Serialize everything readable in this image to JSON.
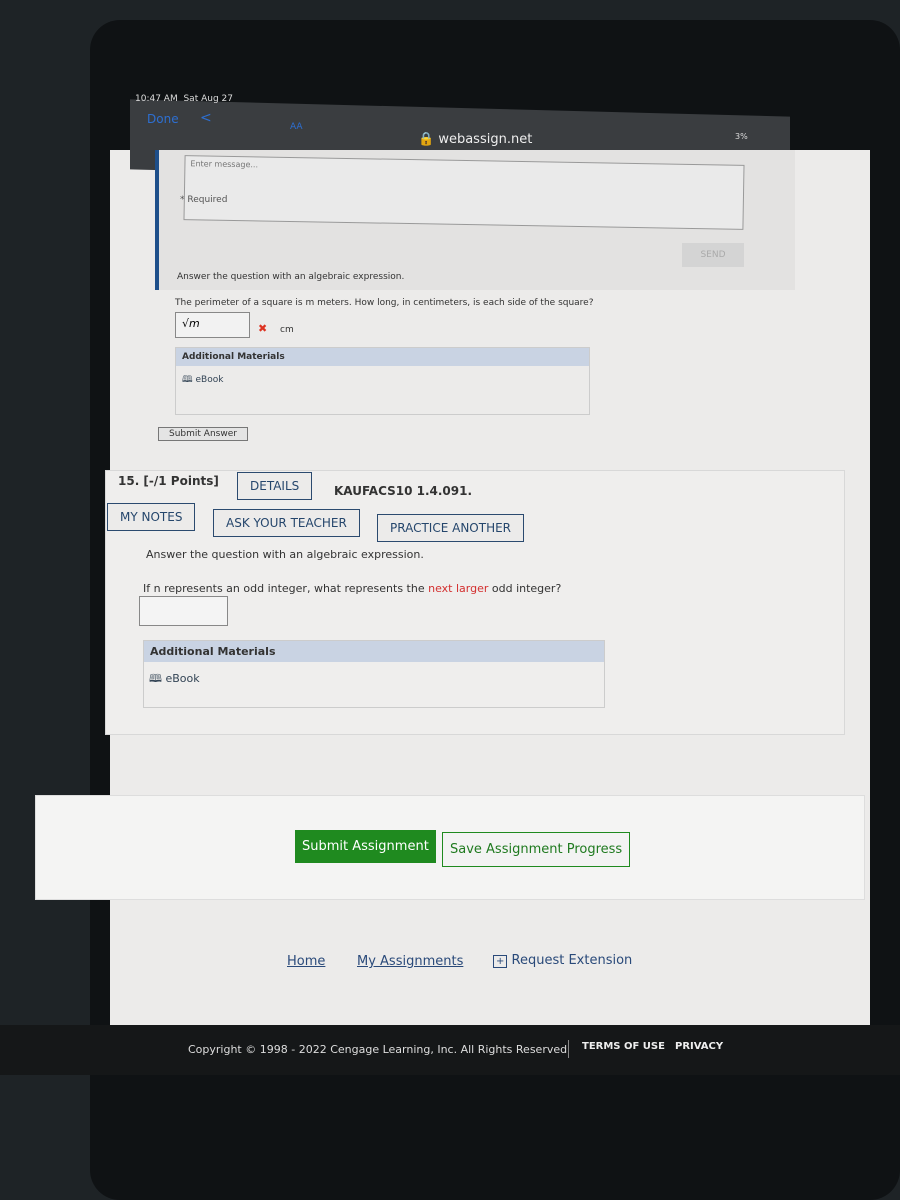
{
  "status": {
    "time": "10:47 AM",
    "date": "Sat Aug 27",
    "battery": "3%"
  },
  "browser": {
    "done": "Done",
    "back": "<",
    "text_size": "AA",
    "url": "webassign.net"
  },
  "message": {
    "placeholder": "Enter message...",
    "required": "* Required",
    "send": "SEND"
  },
  "q14": {
    "instruction": "Answer the question with an algebraic expression.",
    "question": "The perimeter of a square is m meters. How long, in centimeters, is each side of the square?",
    "answer": "√m",
    "unit": "cm",
    "additional": "Additional Materials",
    "ebook": "eBook",
    "submit": "Submit Answer"
  },
  "q15": {
    "number": "15. [-/1 Points]",
    "details": "DETAILS",
    "code": "KAUFACS10 1.4.091.",
    "my_notes": "MY NOTES",
    "ask": "ASK YOUR TEACHER",
    "practice": "PRACTICE ANOTHER",
    "instruction": "Answer the question with an algebraic expression.",
    "q_pre": "If n represents an odd integer, what represents the ",
    "q_red": "next larger",
    "q_post": " odd integer?",
    "answer": "",
    "additional": "Additional Materials",
    "ebook": "eBook"
  },
  "actions": {
    "submit": "Submit Assignment",
    "save": "Save Assignment Progress"
  },
  "links": {
    "home": "Home",
    "assignments": "My Assignments",
    "extension": "Request Extension"
  },
  "footer": {
    "copyright": "Copyright © 1998 - 2022 Cengage Learning, Inc. All Rights Reserved",
    "terms": "TERMS OF USE",
    "privacy": "PRIVACY"
  },
  "colors": {
    "accent": "#1f8a1f",
    "link": "#25466c",
    "error": "#d32f2f"
  }
}
